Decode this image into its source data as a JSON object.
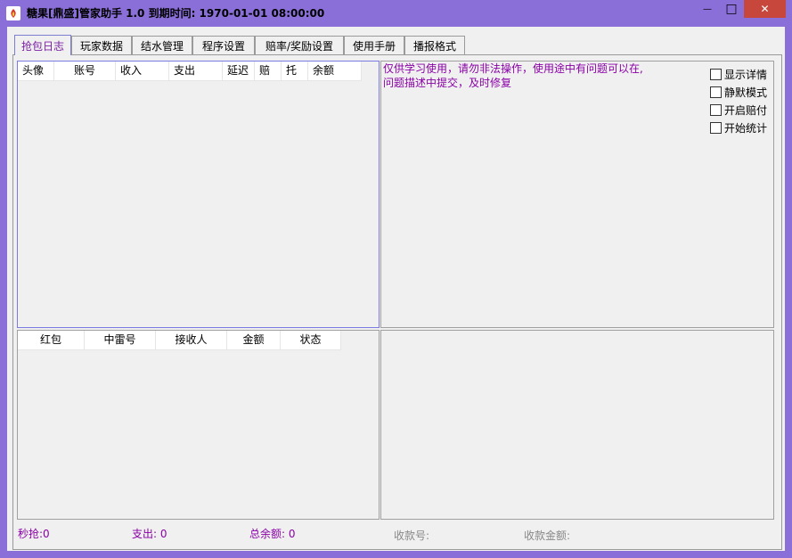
{
  "window": {
    "title": "糖果[鼎盛]管家助手 1.0 到期时间: 1970-01-01 08:00:00",
    "minimize_glyph": "—",
    "maximize_glyph": "□",
    "close_glyph": "✕"
  },
  "tabs": [
    {
      "label": "抢包日志",
      "active": true
    },
    {
      "label": "玩家数据",
      "active": false
    },
    {
      "label": "结水管理",
      "active": false
    },
    {
      "label": "程序设置",
      "active": false
    },
    {
      "label": "赔率/奖励设置",
      "active": false
    },
    {
      "label": "使用手册",
      "active": false
    },
    {
      "label": "播报格式",
      "active": false
    }
  ],
  "log_table": {
    "columns": [
      "头像",
      "账号",
      "收入",
      "支出",
      "延迟",
      "赔",
      "托",
      "余额"
    ],
    "rows": []
  },
  "notice": {
    "line1": "仅供学习使用，请勿非法操作，使用途中有问题可以在,",
    "line2": "问题描述中提交，及时修复"
  },
  "options": [
    {
      "label": "显示详情",
      "checked": false
    },
    {
      "label": "静默模式",
      "checked": false
    },
    {
      "label": "开启赔付",
      "checked": false
    },
    {
      "label": "开始统计",
      "checked": false
    }
  ],
  "packet_table": {
    "columns": [
      "红包",
      "中雷号",
      "接收人",
      "金额",
      "状态"
    ],
    "rows": []
  },
  "status": {
    "seckill_label": "秒抢:",
    "seckill_value": "0",
    "spend_label": "支出:",
    "spend_value": "0",
    "total_label": "总余额:",
    "total_value": "0",
    "account_label": "收款号:",
    "amount_label": "收款金额:"
  },
  "colors": {
    "frame": "#8a6fd8",
    "accent_text": "#8a00a8",
    "close_button": "#c7473c"
  }
}
